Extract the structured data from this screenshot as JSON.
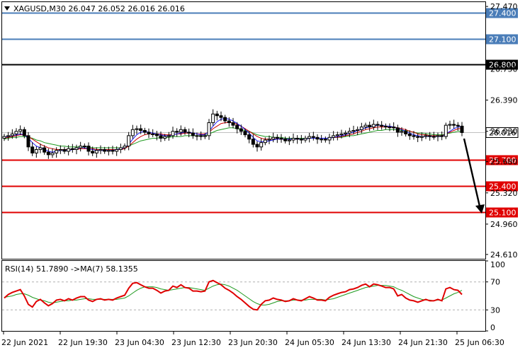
{
  "header": {
    "symbol_line": "XAGUSD,M30  26.047 26.052 26.016 26.016",
    "dropdown_icon": "triangle-down-icon"
  },
  "indicator": {
    "label": "RSI(14) 51.7890   ->MA(7) 58.1355"
  },
  "colors": {
    "blue_level": "#4a7db8",
    "black_level": "#000000",
    "red_level": "#e00000",
    "ma_fast": "#1a1aff",
    "ma_mid": "#cc0000",
    "ma_slow": "#1f9a1f",
    "rsi": "#e00000",
    "rsi_ma": "#1f9a1f",
    "tag_blue_bg": "#4a7db8",
    "tag_red_bg": "#e00000",
    "tag_black_bg": "#000000",
    "current_tag_bg": "#ffffff"
  },
  "price_axis": {
    "ticks": [
      "27.470",
      "26.750",
      "26.390",
      "26.030",
      "25.680",
      "25.320",
      "24.960",
      "24.610"
    ],
    "range": [
      24.56,
      27.52
    ]
  },
  "rsi_axis": {
    "ticks": [
      "100",
      "70",
      "30",
      "0"
    ],
    "range": [
      0,
      100
    ],
    "dashed_levels": [
      70,
      30
    ]
  },
  "levels": [
    {
      "price": 27.4,
      "label": "27.400",
      "kind": "blue"
    },
    {
      "price": 27.1,
      "label": "27.100",
      "kind": "blue"
    },
    {
      "price": 26.8,
      "label": "26.800",
      "kind": "black"
    },
    {
      "price": 25.7,
      "label": "25.700",
      "kind": "red"
    },
    {
      "price": 25.4,
      "label": "25.400",
      "kind": "red"
    },
    {
      "price": 25.1,
      "label": "25.100",
      "kind": "red"
    }
  ],
  "current_price": {
    "price": 26.016,
    "label": "26.016"
  },
  "time_axis": {
    "labels": [
      "22 Jun 2021",
      "22 Jun 19:30",
      "23 Jun 04:30",
      "23 Jun 12:30",
      "23 Jun 20:30",
      "24 Jun 05:30",
      "24 Jun 13:30",
      "24 Jun 21:30",
      "25 Jun 06:30"
    ]
  },
  "chart_data": {
    "type": "candlestick",
    "symbol": "XAGUSD",
    "timeframe": "M30",
    "close": [
      25.97,
      25.98,
      26.0,
      26.03,
      26.05,
      25.98,
      25.85,
      25.78,
      25.82,
      25.84,
      25.79,
      25.76,
      25.78,
      25.81,
      25.82,
      25.8,
      25.83,
      25.82,
      25.84,
      25.86,
      25.86,
      25.8,
      25.78,
      25.81,
      25.82,
      25.8,
      25.81,
      25.8,
      25.82,
      25.84,
      25.86,
      25.98,
      26.05,
      26.06,
      26.04,
      26.02,
      26.0,
      26.0,
      25.98,
      25.95,
      25.97,
      25.98,
      26.03,
      26.02,
      26.05,
      26.02,
      26.01,
      25.98,
      25.98,
      25.97,
      25.98,
      26.13,
      26.23,
      26.21,
      26.19,
      26.15,
      26.13,
      26.1,
      26.06,
      26.03,
      25.99,
      25.94,
      25.88,
      25.85,
      25.9,
      25.93,
      25.94,
      25.96,
      25.95,
      25.94,
      25.92,
      25.93,
      25.95,
      25.94,
      25.93,
      25.95,
      25.97,
      25.96,
      25.94,
      25.94,
      25.93,
      25.96,
      25.98,
      25.99,
      26.0,
      26.01,
      26.03,
      26.04,
      26.05,
      26.08,
      26.1,
      26.08,
      26.11,
      26.1,
      26.09,
      26.08,
      26.08,
      26.07,
      26.02,
      26.03,
      26.0,
      25.98,
      25.97,
      25.96,
      25.97,
      25.98,
      25.97,
      25.97,
      25.98,
      25.97,
      26.1,
      26.11,
      26.1,
      26.09,
      26.016
    ],
    "ma_fast": [
      25.96,
      25.97,
      25.98,
      25.99,
      26.0,
      25.99,
      25.95,
      25.9,
      25.86,
      25.84,
      25.82,
      25.8,
      25.79,
      25.8,
      25.81,
      25.81,
      25.81,
      25.82,
      25.83,
      25.84,
      25.84,
      25.83,
      25.82,
      25.81,
      25.81,
      25.81,
      25.81,
      25.81,
      25.82,
      25.83,
      25.84,
      25.88,
      25.94,
      25.99,
      26.02,
      26.03,
      26.02,
      26.01,
      26.0,
      25.99,
      25.98,
      25.98,
      25.99,
      26.0,
      26.01,
      26.02,
      26.02,
      26.01,
      26.0,
      25.99,
      25.99,
      26.03,
      26.09,
      26.14,
      26.17,
      26.18,
      26.17,
      26.15,
      26.12,
      26.09,
      26.05,
      26.01,
      25.96,
      25.92,
      25.91,
      25.91,
      25.92,
      25.93,
      25.94,
      25.94,
      25.94,
      25.94,
      25.94,
      25.94,
      25.94,
      25.94,
      25.95,
      25.95,
      25.95,
      25.95,
      25.95,
      25.95,
      25.96,
      25.97,
      25.98,
      25.99,
      26.01,
      26.02,
      26.04,
      26.05,
      26.07,
      26.08,
      26.09,
      26.1,
      26.1,
      26.09,
      26.09,
      26.08,
      26.06,
      26.05,
      26.03,
      26.01,
      25.99,
      25.98,
      25.97,
      25.97,
      25.97,
      25.97,
      25.97,
      25.97,
      26.0,
      26.03,
      26.06,
      26.08,
      26.08
    ],
    "ma_mid": [
      25.95,
      25.96,
      25.97,
      25.98,
      25.99,
      25.99,
      25.97,
      25.94,
      25.91,
      25.88,
      25.86,
      25.84,
      25.83,
      25.82,
      25.82,
      25.82,
      25.82,
      25.82,
      25.82,
      25.83,
      25.83,
      25.83,
      25.83,
      25.82,
      25.82,
      25.82,
      25.82,
      25.82,
      25.82,
      25.82,
      25.83,
      25.86,
      25.9,
      25.94,
      25.97,
      25.99,
      26.0,
      26.0,
      26.0,
      26.0,
      25.99,
      25.99,
      25.99,
      26.0,
      26.0,
      26.01,
      26.01,
      26.01,
      26.0,
      26.0,
      26.0,
      26.02,
      26.06,
      26.09,
      26.12,
      26.13,
      26.13,
      26.13,
      26.11,
      26.09,
      26.06,
      26.03,
      26.0,
      25.97,
      25.95,
      25.94,
      25.94,
      25.94,
      25.94,
      25.94,
      25.94,
      25.94,
      25.94,
      25.94,
      25.94,
      25.94,
      25.95,
      25.95,
      25.95,
      25.95,
      25.95,
      25.95,
      25.96,
      25.96,
      25.97,
      25.98,
      25.99,
      26.0,
      26.02,
      26.03,
      26.05,
      26.06,
      26.07,
      26.08,
      26.08,
      26.08,
      26.08,
      26.08,
      26.07,
      26.06,
      26.05,
      26.03,
      26.02,
      26.0,
      25.99,
      25.99,
      25.98,
      25.98,
      25.98,
      25.98,
      26.0,
      26.02,
      26.04,
      26.06,
      26.06
    ],
    "ma_slow": [
      25.94,
      25.95,
      25.96,
      25.96,
      25.97,
      25.97,
      25.96,
      25.95,
      25.93,
      25.92,
      25.9,
      25.89,
      25.88,
      25.87,
      25.86,
      25.86,
      25.85,
      25.85,
      25.85,
      25.85,
      25.85,
      25.85,
      25.84,
      25.84,
      25.84,
      25.84,
      25.84,
      25.84,
      25.84,
      25.84,
      25.84,
      25.86,
      25.88,
      25.9,
      25.92,
      25.93,
      25.94,
      25.95,
      25.95,
      25.96,
      25.96,
      25.96,
      25.97,
      25.97,
      25.97,
      25.98,
      25.98,
      25.98,
      25.98,
      25.98,
      25.98,
      26.0,
      26.02,
      26.04,
      26.05,
      26.06,
      26.07,
      26.07,
      26.06,
      26.05,
      26.04,
      26.03,
      26.01,
      25.99,
      25.98,
      25.97,
      25.97,
      25.96,
      25.96,
      25.96,
      25.95,
      25.95,
      25.95,
      25.95,
      25.95,
      25.95,
      25.95,
      25.95,
      25.95,
      25.95,
      25.95,
      25.95,
      25.96,
      25.96,
      25.96,
      25.97,
      25.98,
      25.98,
      25.99,
      26.0,
      26.01,
      26.02,
      26.03,
      26.04,
      26.04,
      26.05,
      26.05,
      26.05,
      26.05,
      26.04,
      26.04,
      26.03,
      26.02,
      26.01,
      26.01,
      26.0,
      26.0,
      25.99,
      25.99,
      25.99,
      26.0,
      26.01,
      26.02,
      26.03,
      26.03
    ],
    "rsi": [
      47,
      52,
      55,
      57,
      59,
      50,
      38,
      34,
      42,
      45,
      40,
      36,
      39,
      44,
      45,
      43,
      46,
      44,
      47,
      49,
      49,
      44,
      42,
      45,
      46,
      44,
      45,
      44,
      47,
      49,
      51,
      61,
      68,
      69,
      66,
      63,
      61,
      61,
      58,
      54,
      57,
      58,
      64,
      62,
      66,
      62,
      61,
      57,
      57,
      56,
      57,
      70,
      72,
      69,
      66,
      61,
      58,
      54,
      49,
      45,
      40,
      35,
      31,
      30,
      38,
      43,
      44,
      47,
      45,
      44,
      42,
      43,
      46,
      44,
      43,
      46,
      49,
      47,
      44,
      44,
      43,
      48,
      51,
      53,
      55,
      56,
      59,
      60,
      62,
      65,
      67,
      63,
      67,
      66,
      64,
      62,
      62,
      60,
      50,
      52,
      47,
      44,
      43,
      41,
      43,
      45,
      43,
      43,
      45,
      43,
      60,
      62,
      59,
      58,
      52
    ],
    "rsi_ma": [
      48,
      49,
      50,
      52,
      53,
      53,
      51,
      48,
      46,
      44,
      43,
      41,
      40,
      41,
      42,
      43,
      43,
      44,
      44,
      45,
      46,
      46,
      45,
      45,
      45,
      45,
      45,
      45,
      45,
      46,
      47,
      50,
      54,
      58,
      61,
      63,
      63,
      63,
      62,
      60,
      59,
      58,
      59,
      60,
      61,
      62,
      62,
      61,
      60,
      59,
      58,
      61,
      64,
      66,
      67,
      66,
      64,
      61,
      58,
      54,
      50,
      46,
      42,
      39,
      37,
      37,
      38,
      40,
      42,
      43,
      43,
      43,
      44,
      44,
      44,
      44,
      45,
      45,
      45,
      45,
      44,
      45,
      46,
      48,
      50,
      52,
      54,
      56,
      58,
      60,
      62,
      63,
      64,
      65,
      65,
      65,
      64,
      63,
      60,
      58,
      55,
      52,
      49,
      47,
      45,
      44,
      44,
      43,
      44,
      44,
      47,
      50,
      53,
      55,
      58
    ]
  }
}
